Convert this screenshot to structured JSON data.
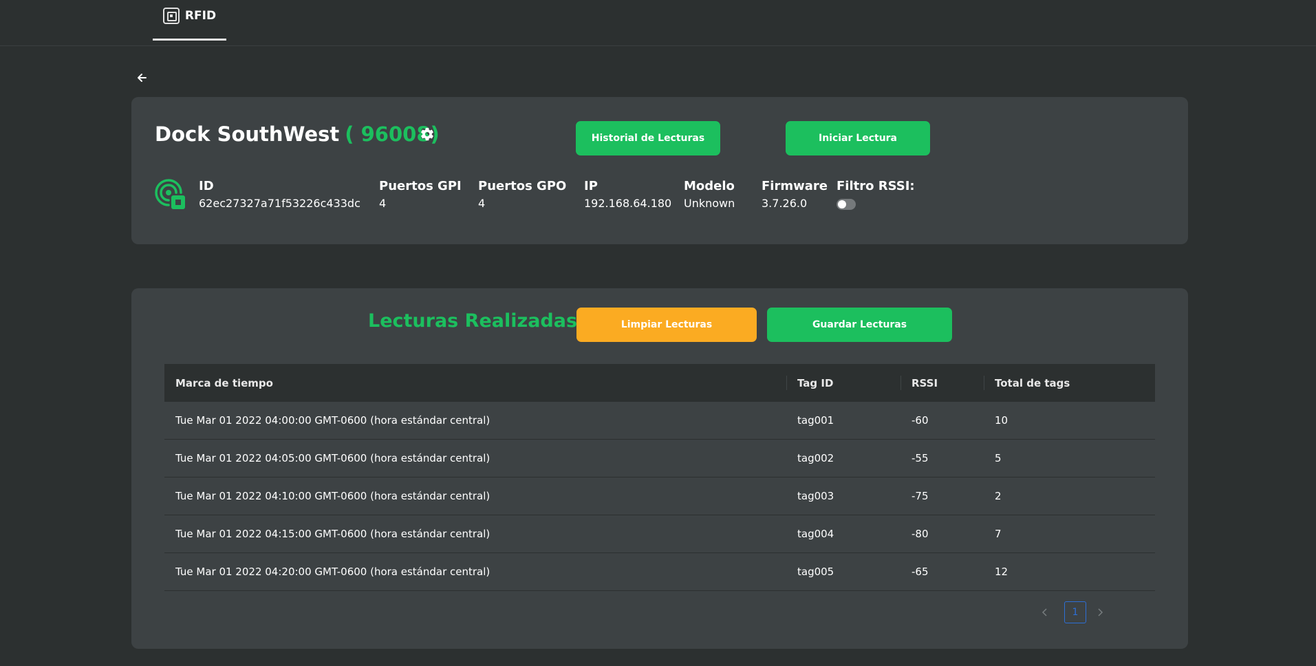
{
  "nav": {
    "tab_label": "RFID",
    "tab_icon": "rfid-chip-icon"
  },
  "back_icon": "back-arrow-icon",
  "reader": {
    "name": "Dock SouthWest",
    "code": "( 96008)",
    "settings_icon": "gear-icon",
    "buttons": {
      "history": "Historial de Lecturas",
      "start": "Iniciar Lectura"
    },
    "icon": "rfid-reader-icon",
    "info": {
      "id_label": "ID",
      "id_value": "62ec27327a71f53226c433dc",
      "gpi_label": "Puertos GPI",
      "gpi_value": "4",
      "gpo_label": "Puertos GPO",
      "gpo_value": "4",
      "ip_label": "IP",
      "ip_value": "192.168.64.180",
      "model_label": "Modelo",
      "model_value": "Unknown",
      "firmware_label": "Firmware",
      "firmware_value": "3.7.26.0",
      "rssi_filter_label": "Filtro RSSI:",
      "rssi_filter_on": false
    }
  },
  "readings": {
    "title": "Lecturas Realizadas",
    "buttons": {
      "clear": "Limpiar Lecturas",
      "save": "Guardar Lecturas"
    },
    "columns": [
      "Marca de tiempo",
      "Tag ID",
      "RSSI",
      "Total de tags"
    ],
    "rows": [
      [
        "Tue Mar 01 2022 04:00:00 GMT-0600 (hora estándar central)",
        "tag001",
        "-60",
        "10"
      ],
      [
        "Tue Mar 01 2022 04:05:00 GMT-0600 (hora estándar central)",
        "tag002",
        "-55",
        "5"
      ],
      [
        "Tue Mar 01 2022 04:10:00 GMT-0600 (hora estándar central)",
        "tag003",
        "-75",
        "2"
      ],
      [
        "Tue Mar 01 2022 04:15:00 GMT-0600 (hora estándar central)",
        "tag004",
        "-80",
        "7"
      ],
      [
        "Tue Mar 01 2022 04:20:00 GMT-0600 (hora estándar central)",
        "tag005",
        "-65",
        "12"
      ]
    ],
    "pagination": {
      "prev_icon": "chevron-left-icon",
      "current_page": "1",
      "next_icon": "chevron-right-icon"
    }
  },
  "colors": {
    "background": "#2c3030",
    "card": "#3d4244",
    "accent_green": "#1cbf5e",
    "accent_orange": "#fbab22",
    "pagination_blue": "#2d6fd6"
  }
}
